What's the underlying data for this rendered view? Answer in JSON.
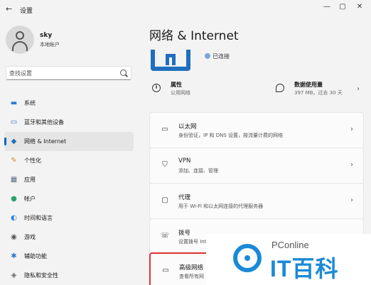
{
  "window": {
    "title": "设置",
    "back_icon": "back-arrow-icon",
    "min": "—",
    "max": "▢",
    "close": "✕"
  },
  "user": {
    "name": "sky",
    "type": "本地帐户"
  },
  "search": {
    "placeholder": "查找设置"
  },
  "sidebar": {
    "items": [
      {
        "label": "系统",
        "icon": "monitor-icon",
        "glyph": "▬",
        "color": "#2a7bd1"
      },
      {
        "label": "蓝牙和其他设备",
        "icon": "bluetooth-devices-icon",
        "glyph": "▭",
        "color": "#2a7bd1"
      },
      {
        "label": "网络 & Internet",
        "icon": "wifi-icon",
        "glyph": "◆",
        "color": "#1f6fbf"
      },
      {
        "label": "个性化",
        "icon": "brush-icon",
        "glyph": "✎",
        "color": "#d08a2c"
      },
      {
        "label": "应用",
        "icon": "apps-icon",
        "glyph": "▦",
        "color": "#5a6f8a"
      },
      {
        "label": "帐户",
        "icon": "account-icon",
        "glyph": "●",
        "color": "#2aa36f"
      },
      {
        "label": "时间和语言",
        "icon": "globe-clock-icon",
        "glyph": "◐",
        "color": "#2a7bd1"
      },
      {
        "label": "游戏",
        "icon": "gamepad-icon",
        "glyph": "◉",
        "color": "#555555"
      },
      {
        "label": "辅助功能",
        "icon": "accessibility-icon",
        "glyph": "✱",
        "color": "#2a7bd1"
      },
      {
        "label": "隐私和安全性",
        "icon": "shield-icon",
        "glyph": "◈",
        "color": "#666666"
      }
    ],
    "active_index": 2
  },
  "main": {
    "title": "网络 & Internet",
    "status": "已连接",
    "properties": {
      "label": "属性",
      "sub": "公用网络"
    },
    "data_usage": {
      "label": "数据使用量",
      "sub": "397 MB，过去 30 天"
    },
    "cards": [
      {
        "title": "以太网",
        "desc": "身份验证，IP 和 DNS 设置，按流量计费的网络",
        "icon": "ethernet-icon",
        "glyph": "▭"
      },
      {
        "title": "VPN",
        "desc": "添加、连接、管理",
        "icon": "vpn-shield-icon",
        "glyph": "⛉"
      },
      {
        "title": "代理",
        "desc": "用于 Wi-Fi 和以太网连接的代理服务器",
        "icon": "proxy-icon",
        "glyph": "▢"
      },
      {
        "title": "拨号",
        "desc": "设置拨号 Internet 连接",
        "icon": "dialup-icon",
        "glyph": "☏"
      },
      {
        "title": "高级网络",
        "desc": "查看所有网",
        "icon": "advanced-network-icon",
        "glyph": "▭"
      }
    ]
  },
  "watermark": {
    "line1": "PConline",
    "line2": "IT百科",
    "color": "#1b8ad6"
  }
}
